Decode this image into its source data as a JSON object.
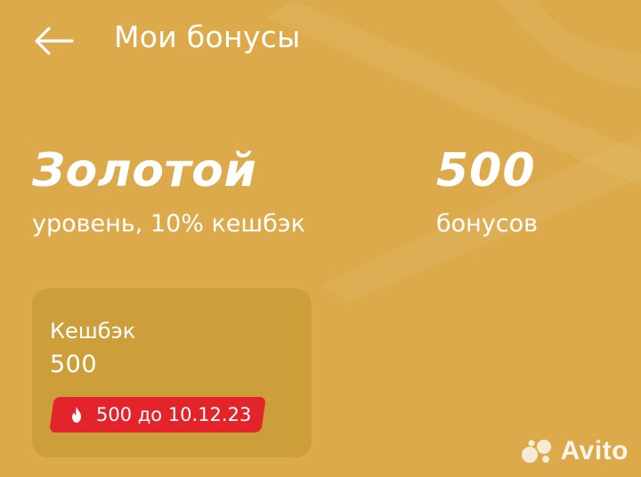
{
  "header": {
    "back_icon": "arrow-left-icon",
    "title": "Мои бонусы"
  },
  "status": {
    "level_name": "Золотой",
    "level_desc": "уровень, 10% кешбэк",
    "bonus_value": "500",
    "bonus_label": "бонусов"
  },
  "cashback_card": {
    "title": "Кешбэк",
    "value": "500",
    "expiry_icon": "fire-icon",
    "expiry_text": "500 до 10.12.23"
  },
  "watermark": {
    "text": "Avito"
  },
  "colors": {
    "background": "#dcaa4a",
    "card": "#cc9f3a",
    "badge": "#e3242b",
    "text": "#ffffff"
  }
}
